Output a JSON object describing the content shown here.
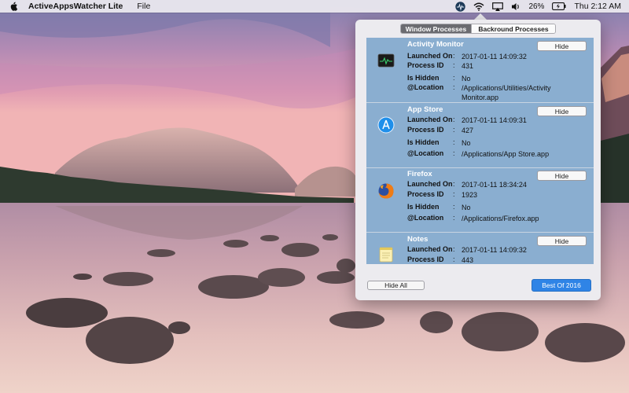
{
  "menubar": {
    "apple_icon": "apple-logo-icon",
    "app_name": "ActiveAppsWatcher Lite",
    "menus": [
      "File"
    ],
    "status": {
      "battery_percent": "26%",
      "clock": "Thu 2:12 AM",
      "icons": [
        "activeappswatcher-icon",
        "wifi-icon",
        "airplay-icon",
        "volume-icon",
        "battery-icon",
        "search-icon",
        "siri-icon",
        "menu-list-icon"
      ]
    }
  },
  "popover": {
    "tabs": [
      {
        "label": "Window Processes",
        "selected": true
      },
      {
        "label": "Backround Processes",
        "selected": false
      }
    ],
    "processes": [
      {
        "name": "Activity Monitor",
        "icon": "activity-monitor-icon",
        "hide_label": "Hide",
        "fields": [
          {
            "label": "Launched On",
            "value": "2017-01-11 14:09:32"
          },
          {
            "label": "Process ID",
            "value": "431"
          },
          {
            "label": "Is Hidden",
            "value": "No"
          },
          {
            "label": "@Location",
            "value": "/Applications/Utilities/Activity Monitor.app"
          }
        ]
      },
      {
        "name": "App Store",
        "icon": "app-store-icon",
        "hide_label": "Hide",
        "fields": [
          {
            "label": "Launched On",
            "value": "2017-01-11 14:09:31"
          },
          {
            "label": "Process ID",
            "value": "427"
          },
          {
            "label": "Is Hidden",
            "value": "No"
          },
          {
            "label": "@Location",
            "value": "/Applications/App Store.app"
          }
        ]
      },
      {
        "name": "Firefox",
        "icon": "firefox-icon",
        "hide_label": "Hide",
        "fields": [
          {
            "label": "Launched On",
            "value": "2017-01-11 18:34:24"
          },
          {
            "label": "Process ID",
            "value": "1923"
          },
          {
            "label": "Is Hidden",
            "value": "No"
          },
          {
            "label": "@Location",
            "value": "/Applications/Firefox.app"
          }
        ]
      },
      {
        "name": "Notes",
        "icon": "notes-icon",
        "hide_label": "Hide",
        "fields": [
          {
            "label": "Launched On",
            "value": "2017-01-11 14:09:32"
          },
          {
            "label": "Process ID",
            "value": "443"
          }
        ]
      }
    ],
    "colon": ":",
    "hide_all_label": "Hide All",
    "best_label": "Best Of 2016"
  }
}
